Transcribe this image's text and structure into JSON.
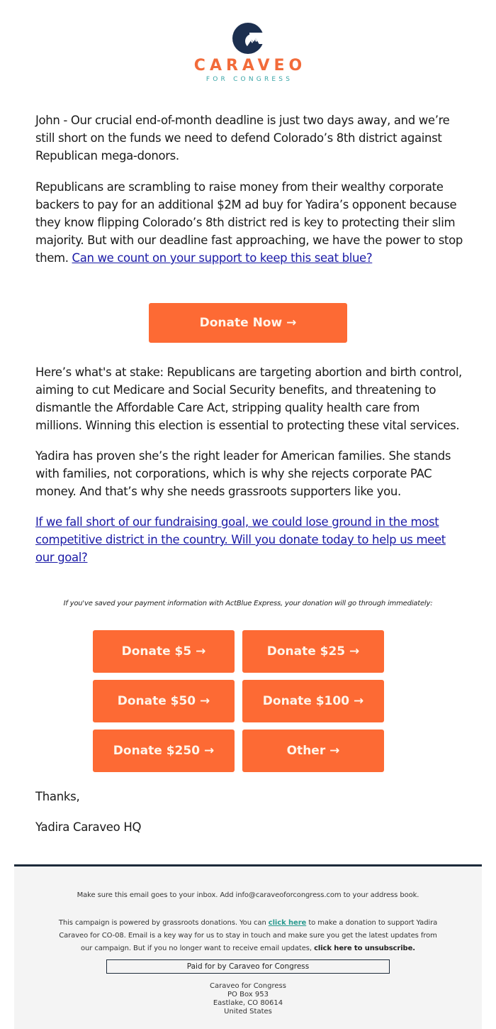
{
  "header": {
    "logo_word": "CARAVEO",
    "logo_sub": "FOR CONGRESS",
    "brand_colors": {
      "orange": "#f26b3a",
      "navy": "#1c2f4f",
      "teal": "#3aa6a8"
    }
  },
  "body": {
    "p1": "John - Our crucial end-of-month deadline is just two days away, and we’re still short on the funds we need to defend Colorado’s 8th district against Republican mega-donors.",
    "p2_text": "Republicans are scrambling to raise money from their wealthy corporate backers to pay for an additional $2M ad buy for Yadira’s opponent because they know flipping Colorado’s 8th district red is key to protecting their slim majority. But with our deadline fast approaching, we have the power to stop them. ",
    "p2_link": "Can we count on your support to keep this seat blue?",
    "donate_now_label": "Donate Now →",
    "p3": "Here’s what's at stake: Republicans are targeting abortion and birth control, aiming to cut Medicare and Social Security benefits, and threatening to dismantle the Affordable Care Act, stripping quality health care from millions. Winning this election is essential to protecting these vital services.",
    "p4": "Yadira has proven she’s the right leader for American families. She stands with families, not corporations, which is why she rejects corporate PAC money. And that’s why she needs grassroots supporters like you.",
    "p5_link": "If we fall short of our fundraising goal, we could lose ground in the most competitive district in the country. Will you donate today to help us meet our goal?",
    "actblue_note": "If you've saved your payment information with ActBlue Express, your donation will go through immediately:",
    "donate_buttons": [
      {
        "label": "Donate $5 →"
      },
      {
        "label": "Donate $25 →"
      },
      {
        "label": "Donate $50 →"
      },
      {
        "label": "Donate $100 →"
      },
      {
        "label": "Donate $250 →"
      },
      {
        "label": "Other →"
      }
    ],
    "signoff": "Thanks,",
    "signature": "Yadira Caraveo HQ"
  },
  "footer": {
    "inbox_note": "Make sure this email goes to your inbox. Add info@caraveoforcongress.com to your address book.",
    "para_before": "This campaign is powered by grassroots donations. You can ",
    "click_here": "click here",
    "para_middle": " to make a donation to support Yadira Caraveo for CO-08. Email is a key way for us to stay in touch and make sure you get the latest updates from our campaign. But if you no longer want to receive email updates, ",
    "unsubscribe": "click here to unsubscribe.",
    "paid_for": "Paid for by Caraveo for Congress",
    "address": [
      "Caraveo for Congress",
      "PO Box 953",
      "Eastlake, CO 80614",
      "United States"
    ]
  }
}
